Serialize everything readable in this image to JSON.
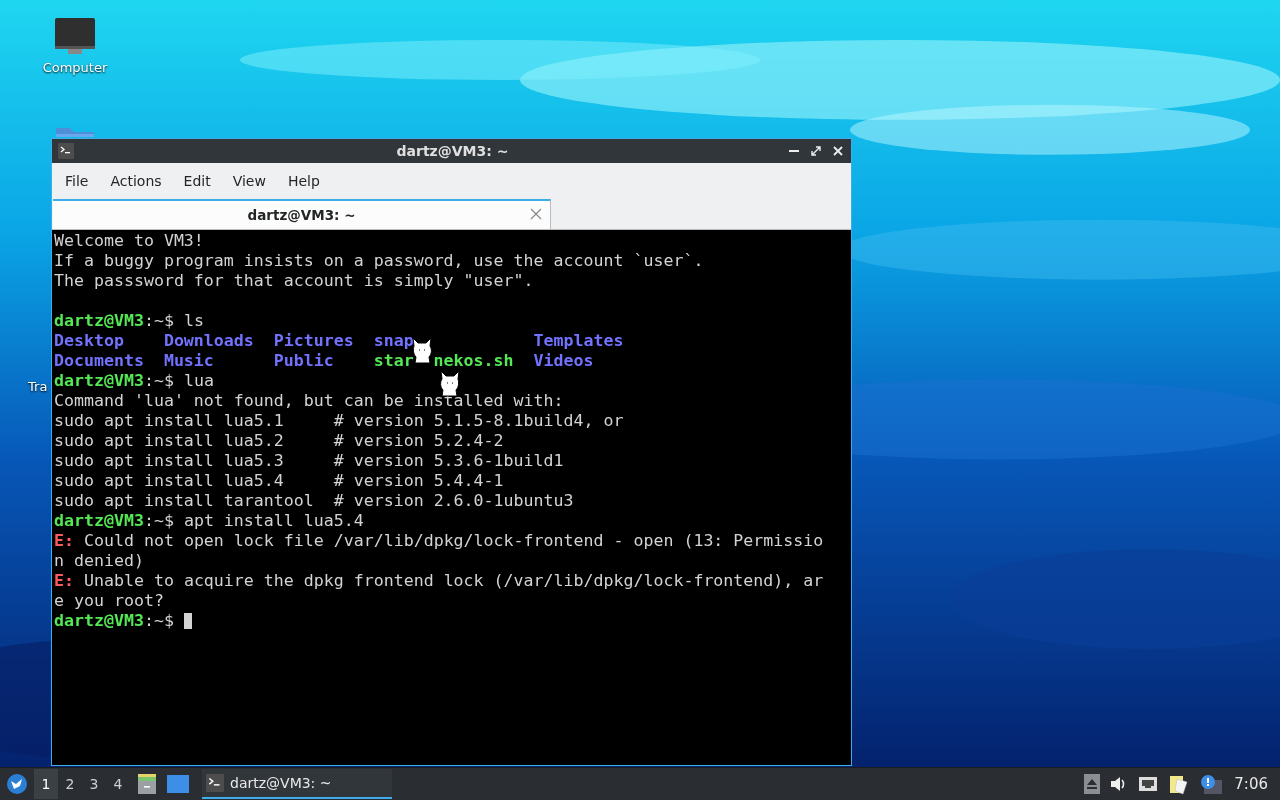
{
  "desktop": {
    "icons": [
      {
        "kind": "computer",
        "label": "Computer"
      },
      {
        "kind": "folder"
      },
      {
        "kind": "trash",
        "label": "Tra"
      }
    ]
  },
  "window": {
    "title": "dartz@VM3: ~",
    "menu": [
      "File",
      "Actions",
      "Edit",
      "View",
      "Help"
    ],
    "tabs": [
      {
        "label": "dartz@VM3: ~",
        "selected": true
      }
    ],
    "terminal": {
      "lines": [
        {
          "kind": "output",
          "text": "Welcome to VM3!"
        },
        {
          "kind": "output",
          "text": "If a buggy program insists on a password, use the account `user`."
        },
        {
          "kind": "output",
          "text": "The passsword for that account is simply \"user\"."
        },
        {
          "kind": "blank"
        },
        {
          "kind": "prompt",
          "user": "dartz@VM3",
          "path": ":~$",
          "command": "ls",
          "cursor": false
        },
        {
          "kind": "ls",
          "entries": [
            {
              "kind": "dir",
              "parts": [
                "Desktop"
              ]
            },
            {
              "kind": "dir",
              "parts": [
                "Downloads"
              ]
            },
            {
              "kind": "dir",
              "parts": [
                "Pictures"
              ]
            },
            {
              "kind": "dir",
              "parts": [
                "snap"
              ]
            },
            {
              "kind": "dir",
              "parts": [
                "Templates"
              ]
            }
          ]
        },
        {
          "kind": "ls",
          "entries": [
            {
              "kind": "dir",
              "parts": [
                "Documents"
              ]
            },
            {
              "kind": "dir",
              "parts": [
                "Music"
              ]
            },
            {
              "kind": "dir",
              "parts": [
                "Public"
              ]
            },
            {
              "kind": "exec",
              "parts": [
                "star",
                "nekos.sh"
              ]
            },
            {
              "kind": "dir",
              "parts": [
                "Videos"
              ]
            }
          ]
        },
        {
          "kind": "prompt",
          "user": "dartz@VM3",
          "path": ":~$",
          "command": "lua",
          "cursor": false
        },
        {
          "kind": "output",
          "text": "Command 'lua' not found, but can be installed with:"
        },
        {
          "kind": "output",
          "text": "sudo apt install lua5.1     # version 5.1.5-8.1build4, or"
        },
        {
          "kind": "output",
          "text": "sudo apt install lua5.2     # version 5.2.4-2"
        },
        {
          "kind": "output",
          "text": "sudo apt install lua5.3     # version 5.3.6-1build1"
        },
        {
          "kind": "output",
          "text": "sudo apt install lua5.4     # version 5.4.4-1"
        },
        {
          "kind": "output",
          "text": "sudo apt install tarantool  # version 2.6.0-1ubuntu3"
        },
        {
          "kind": "prompt",
          "user": "dartz@VM3",
          "path": ":~$",
          "command": "apt install lua5.4",
          "cursor": false
        },
        {
          "kind": "error",
          "tag": "E:",
          "text": "Could not open lock file /var/lib/dpkg/lock-frontend - open (13: Permission denied)"
        },
        {
          "kind": "error",
          "tag": "E:",
          "text": "Unable to acquire the dpkg frontend lock (/var/lib/dpkg/lock-frontend), are you root?"
        },
        {
          "kind": "prompt",
          "user": "dartz@VM3",
          "path": ":~$",
          "cursor": true
        }
      ]
    }
  },
  "taskbar": {
    "desktops": [
      {
        "label": "1",
        "selected": true
      },
      {
        "label": "2",
        "selected": false
      },
      {
        "label": "3",
        "selected": false
      },
      {
        "label": "4",
        "selected": false
      }
    ],
    "launchers": [
      {
        "kind": "files"
      },
      {
        "kind": "desktop"
      }
    ],
    "tasks": [
      {
        "label": "dartz@VM3: ~",
        "selected": true
      }
    ],
    "tray": [
      {
        "kind": "eject"
      },
      {
        "kind": "volume"
      },
      {
        "kind": "network"
      },
      {
        "kind": "clipboard"
      },
      {
        "kind": "notification"
      }
    ],
    "clock": "7:06"
  }
}
